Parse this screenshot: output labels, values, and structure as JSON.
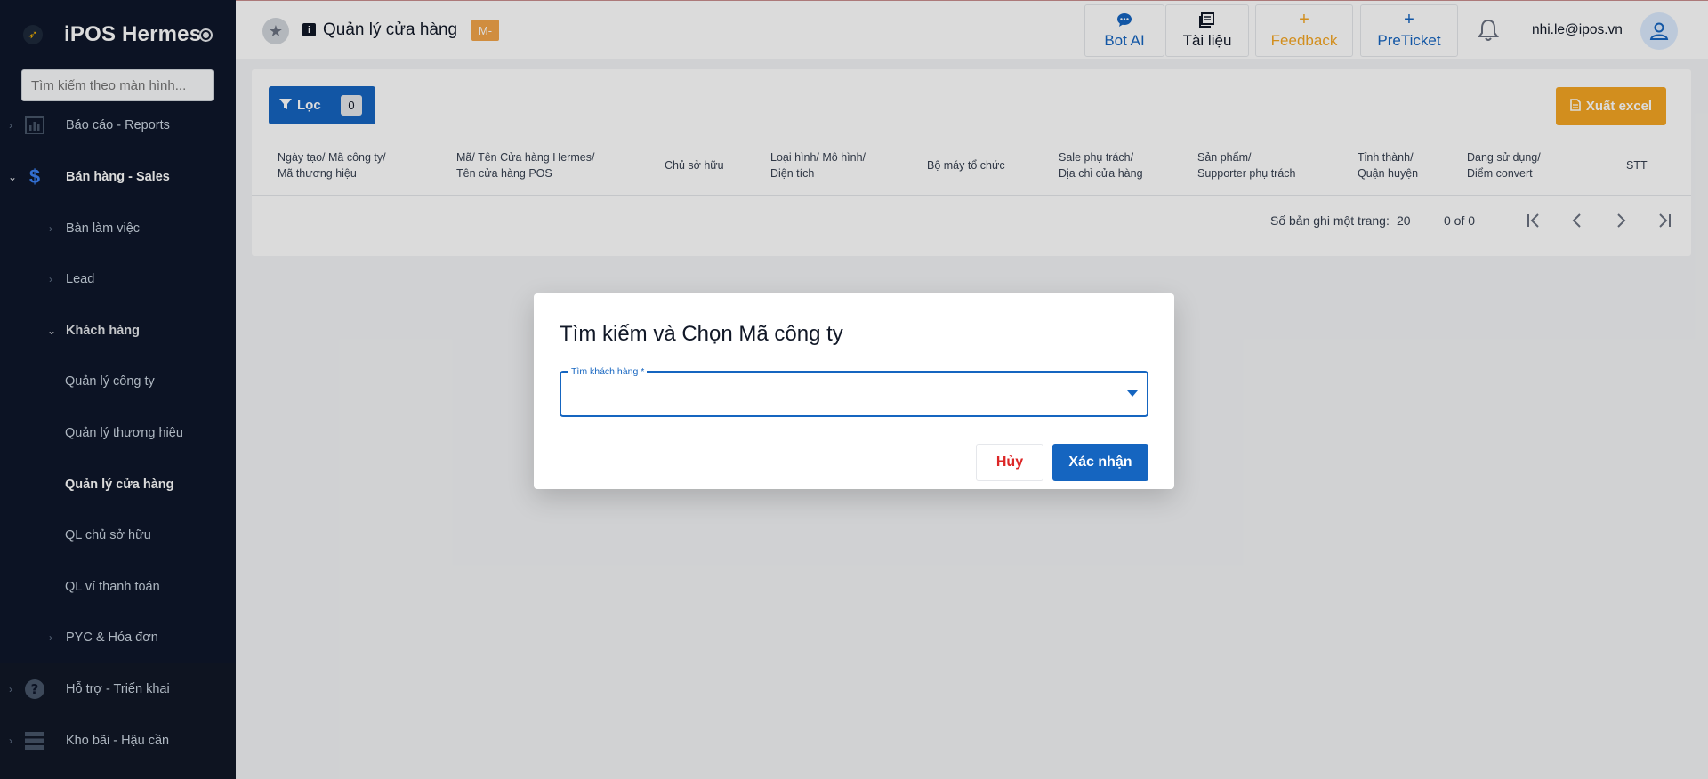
{
  "app": {
    "brand": "iPOS Hermes",
    "search_placeholder": "Tìm kiếm theo màn hình..."
  },
  "sidebar": {
    "items": [
      {
        "label": "Báo cáo - Reports",
        "icon": "bar-chart-icon"
      },
      {
        "label": "Bán hàng - Sales",
        "icon": "dollar-icon",
        "expanded": true
      },
      {
        "label": "Bàn làm việc"
      },
      {
        "label": "Lead"
      },
      {
        "label": "Khách hàng",
        "expanded": true
      },
      {
        "label": "Quản lý công ty"
      },
      {
        "label": "Quản lý thương hiệu"
      },
      {
        "label": "Quản lý cửa hàng",
        "active": true
      },
      {
        "label": "QL chủ sở hữu"
      },
      {
        "label": "QL ví thanh toán"
      },
      {
        "label": "PYC & Hóa đơn"
      },
      {
        "label": "Hỗ trợ - Triển khai",
        "icon": "help-circle-icon"
      },
      {
        "label": "Kho bãi - Hậu cần",
        "icon": "storage-icon"
      }
    ]
  },
  "header": {
    "page_title": "Quản lý cửa hàng",
    "badge": "M-",
    "buttons": [
      {
        "label": "Bot AI",
        "icon": "chat-icon",
        "color": "#1565c0"
      },
      {
        "label": "Tài liệu",
        "icon": "book-icon",
        "color": "#111827"
      },
      {
        "label": "Feedback",
        "icon": "plus-icon",
        "color": "#f5a623"
      },
      {
        "label": "PreTicket",
        "icon": "plus-icon",
        "color": "#1565c0"
      }
    ],
    "user_email": "nhi.le@ipos.vn"
  },
  "toolbar": {
    "filter_label": "Lọc",
    "filter_count": "0",
    "export_label": "Xuất excel"
  },
  "table": {
    "columns": [
      "Ngày tạo/ Mã công ty/\nMã thương hiệu",
      "Mã/ Tên Cửa hàng Hermes/\nTên cửa hàng POS",
      "Chủ sở hữu",
      "Loại hình/ Mô hình/\nDiện tích",
      "Bộ máy tổ chức",
      "Sale phụ trách/\nĐịa chỉ cửa hàng",
      "Sản phẩm/\nSupporter phụ trách",
      "Tỉnh thành/\nQuận huyện",
      "Đang sử dụng/\nĐiểm convert",
      "STT"
    ],
    "rows_per_page_label": "Số bản ghi một trang:",
    "rows_per_page": "20",
    "range": "0 of 0"
  },
  "dialog": {
    "title": "Tìm kiếm và Chọn Mã công ty",
    "field_label": "Tìm khách hàng *",
    "field_value": "",
    "cancel_label": "Hủy",
    "confirm_label": "Xác nhận"
  }
}
